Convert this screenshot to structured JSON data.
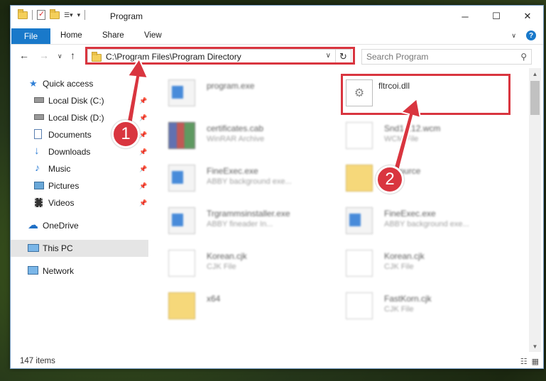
{
  "window": {
    "title": "Program"
  },
  "ribbon": {
    "tabs": [
      "File",
      "Home",
      "Share",
      "View"
    ]
  },
  "nav": {
    "address": "C:\\Program Files\\Program Directory",
    "search_placeholder": "Search Program"
  },
  "sidebar": {
    "items": [
      {
        "label": "Quick access",
        "icon": "star-icon"
      },
      {
        "label": "Local Disk (C:)",
        "icon": "drive-icon",
        "pinned": true
      },
      {
        "label": "Local Disk (D:)",
        "icon": "drive-icon",
        "pinned": true
      },
      {
        "label": "Documents",
        "icon": "documents-icon",
        "pinned": true
      },
      {
        "label": "Downloads",
        "icon": "download-icon",
        "pinned": true
      },
      {
        "label": "Music",
        "icon": "music-icon",
        "pinned": true
      },
      {
        "label": "Pictures",
        "icon": "pictures-icon",
        "pinned": true
      },
      {
        "label": "Videos",
        "icon": "videos-icon",
        "pinned": true
      },
      {
        "label": "OneDrive",
        "icon": "cloud-icon"
      },
      {
        "label": "This PC",
        "icon": "computer-icon",
        "selected": true
      },
      {
        "label": "Network",
        "icon": "network-icon"
      }
    ]
  },
  "files": [
    {
      "name": "program.exe",
      "type": "",
      "icon": "app-icon"
    },
    {
      "name": "fltrcoi.dll",
      "type": "",
      "icon": "dll-gear-icon"
    },
    {
      "name": "certificates.cab",
      "type": "WinRAR Archive",
      "icon": "archive-icon"
    },
    {
      "name": "Snd1...12.wcm",
      "type": "WCM File",
      "icon": "document-icon"
    },
    {
      "name": "FineExec.exe",
      "type": "ABBY background exe...",
      "icon": "app-icon"
    },
    {
      "name": "Resource",
      "type": "",
      "icon": "folder-icon"
    },
    {
      "name": "Trgrammsinstaller.exe",
      "type": "ABBY fineader In...",
      "icon": "app-icon"
    },
    {
      "name": "FineExec.exe",
      "type": "ABBY background exe...",
      "icon": "app-icon"
    },
    {
      "name": "Korean.cjk",
      "type": "CJK File",
      "icon": "document-icon"
    },
    {
      "name": "Korean.cjk",
      "type": "CJK File",
      "icon": "document-icon"
    },
    {
      "name": "x64",
      "type": "",
      "icon": "folder-icon"
    },
    {
      "name": "FastKorn.cjk",
      "type": "CJK File",
      "icon": "document-icon"
    }
  ],
  "status": {
    "items": "147 items"
  },
  "annotations": {
    "badge1": "1",
    "badge2": "2",
    "color": "#d9353f"
  }
}
